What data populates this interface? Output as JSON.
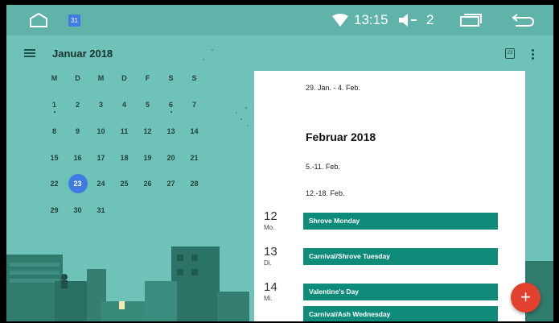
{
  "statusbar": {
    "time": "13:15",
    "volume_level": "2",
    "calendar_app_day": "31"
  },
  "calendar": {
    "month_title": "Januar 2018",
    "weekdays": [
      "M",
      "D",
      "M",
      "D",
      "F",
      "S",
      "S"
    ],
    "weeks": [
      [
        "1",
        "2",
        "3",
        "4",
        "5",
        "6",
        "7"
      ],
      [
        "8",
        "9",
        "10",
        "11",
        "12",
        "13",
        "14"
      ],
      [
        "15",
        "16",
        "17",
        "18",
        "19",
        "20",
        "21"
      ],
      [
        "22",
        "23",
        "24",
        "25",
        "26",
        "27",
        "28"
      ],
      [
        "29",
        "30",
        "31"
      ]
    ],
    "today": "23",
    "today_button_label": "23"
  },
  "schedule": {
    "week1": "29. Jan. - 4. Feb.",
    "month_header": "Februar 2018",
    "week2": "5.-11. Feb.",
    "week3": "12.-18. Feb.",
    "days": [
      {
        "num": "12",
        "dow": "Mo.",
        "events": [
          "Shrove Monday"
        ]
      },
      {
        "num": "13",
        "dow": "Di.",
        "events": [
          "Carnival/Shrove Tuesday"
        ]
      },
      {
        "num": "14",
        "dow": "Mi.",
        "events": [
          "Valentine's Day",
          "Carnival/Ash Wednesday"
        ]
      }
    ]
  },
  "fab": {
    "label": "+"
  },
  "colors": {
    "background": "#6fc2b7",
    "event": "#0f8c79",
    "today": "#3f7be0",
    "fab": "#e2412d"
  }
}
